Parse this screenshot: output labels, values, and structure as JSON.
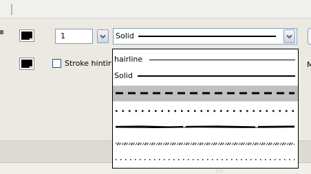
{
  "stroke": {
    "width_value": "1",
    "style_selected": "Solid",
    "hinting_label": "Stroke hinting",
    "hinting_checked": false
  },
  "style_options": [
    {
      "label": "hairline",
      "pattern": "hairline"
    },
    {
      "label": "Solid",
      "pattern": "solid"
    },
    {
      "label": "",
      "pattern": "dashed",
      "selected": true
    },
    {
      "label": "",
      "pattern": "dotted"
    },
    {
      "label": "",
      "pattern": "ragged"
    },
    {
      "label": "",
      "pattern": "stipple"
    },
    {
      "label": "",
      "pattern": "hatched"
    }
  ],
  "right_edge_text": "M",
  "colors": {
    "swatch_stroke": "#000000",
    "swatch_fill": "#000000",
    "selected_row": "#c0c0c0"
  },
  "icons": {
    "color_picker": "color-swatch-icon",
    "dropdown": "chevron-down-icon"
  }
}
